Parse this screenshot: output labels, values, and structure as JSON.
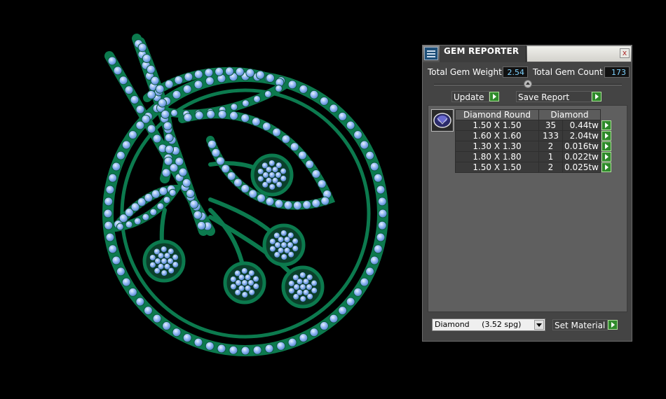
{
  "viewport": {
    "name": "jewelry-3d-model"
  },
  "window": {
    "title": "GEM REPORTER",
    "close_label": "x"
  },
  "stats": {
    "total_weight_label": "Total Gem Weight",
    "total_weight_value": "2.54",
    "total_count_label": "Total Gem Count",
    "total_count_value": "173"
  },
  "toolbar": {
    "update_label": "Update",
    "save_report_label": "Save Report"
  },
  "table": {
    "headers": [
      "Diamond Round",
      "Diamond"
    ],
    "rows": [
      {
        "size": "1.50 X 1.50",
        "count": "35",
        "weight": "0.44tw"
      },
      {
        "size": "1.60 X 1.60",
        "count": "133",
        "weight": "2.04tw"
      },
      {
        "size": "1.30 X 1.30",
        "count": "2",
        "weight": "0.016tw"
      },
      {
        "size": "1.80 X 1.80",
        "count": "1",
        "weight": "0.022tw"
      },
      {
        "size": "1.50 X 1.50",
        "count": "2",
        "weight": "0.025tw"
      }
    ]
  },
  "material": {
    "selected": "Diamond     (3.52 spg)",
    "set_label": "Set Material"
  },
  "colors": {
    "metal": "#0c7a4e",
    "gem": "#8ab4f0",
    "panel": "#444444",
    "go": "#2f8a2b"
  }
}
